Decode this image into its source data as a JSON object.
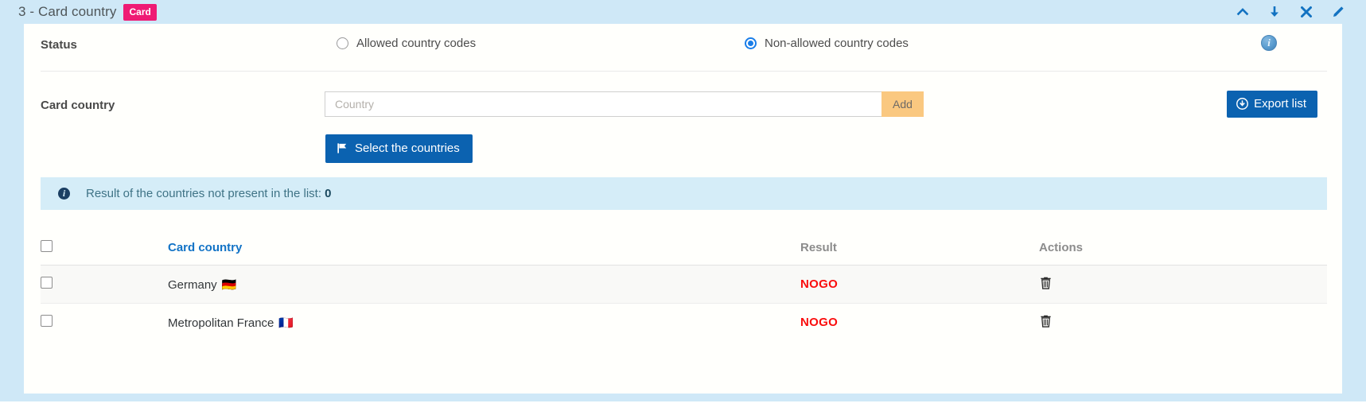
{
  "section": {
    "title": "3 - Card country",
    "badge": "Card",
    "header_icons": [
      {
        "name": "chevron-up-icon",
        "title": "Collapse"
      },
      {
        "name": "arrow-down-icon",
        "title": "Move down"
      },
      {
        "name": "close-icon",
        "title": "Remove"
      },
      {
        "name": "pencil-icon",
        "title": "Edit"
      }
    ]
  },
  "status_row": {
    "label": "Status",
    "options": [
      {
        "label": "Allowed country codes",
        "selected": false
      },
      {
        "label": "Non-allowed country codes",
        "selected": true
      }
    ],
    "info_icon": "i",
    "info_icon_name": "info-icon"
  },
  "input_row": {
    "label": "Card country",
    "placeholder": "Country",
    "value": "",
    "add_label": "Add",
    "export_label": "Export list",
    "export_icon": "download-circle-icon"
  },
  "select_button": {
    "label": "Select the countries",
    "icon": "flag-icon"
  },
  "info_banner": {
    "icon": "info-icon",
    "text": "Result of the countries not present in the list:",
    "count": "0"
  },
  "table": {
    "headers": {
      "select_all": "",
      "name": "Card country",
      "result": "Result",
      "actions": "Actions"
    },
    "rows": [
      {
        "name": "Germany",
        "flag": "🇩🇪",
        "result": "NOGO",
        "action_icon": "trash-icon"
      },
      {
        "name": "Metropolitan France",
        "flag": "🇫🇷",
        "result": "NOGO",
        "action_icon": "trash-icon"
      }
    ]
  },
  "colors": {
    "page_background": "#cfe8f7",
    "panel_background": "#fffffc",
    "badge": "#ef1a74",
    "primary_button": "#0b62b0",
    "add_button": "#fac880",
    "banner_background": "#d5edf8",
    "result_nogo": "#fa0d0d",
    "link": "#1273c6"
  }
}
